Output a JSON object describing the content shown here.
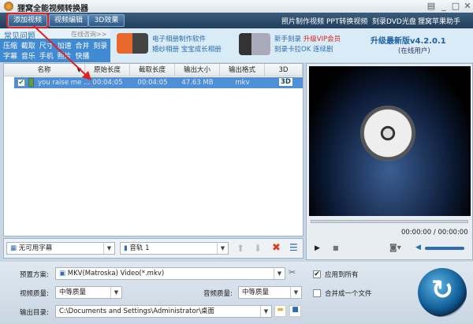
{
  "window": {
    "title": "狸窝全能视频转换器"
  },
  "toolbar": {
    "add_video": "添加视频",
    "edit_video": "视频编辑",
    "effect_3d": "3D效果",
    "links": [
      "照片制作视频",
      "PPT转换视频",
      "刻录DVD光盘",
      "狸窝苹果助手"
    ]
  },
  "faq": {
    "title": "常见问题",
    "online": "在线咨询>>",
    "row1": "压缩 截取 尺寸 加速 合并 刻录",
    "row2": "字幕 音乐 手机 照片 快播"
  },
  "promo1": {
    "line1": "电子相册制作软件",
    "line2": "婚纱相册  宝宝成长相册"
  },
  "promo2": {
    "line1": "新手刻录",
    "vip": "升级VIP会员",
    "line2": "刻录卡拉OK 连续剧"
  },
  "upgrade": {
    "title": "升级最新版v4.2.0.1",
    "sub": "(在线用户)"
  },
  "table": {
    "headers": [
      "名称",
      "原始长度",
      "截取长度",
      "输出大小",
      "输出格式",
      "3D"
    ],
    "rows": [
      {
        "checked": true,
        "name": "you raise me ...",
        "original": "00:04:05",
        "clip": "00:04:05",
        "size": "47.63 MB",
        "format": "mkv",
        "d3": "3D"
      }
    ]
  },
  "player": {
    "time": "00:00:00 / 00:00:00"
  },
  "subtitle": {
    "value": "无可用字幕"
  },
  "audio_track": {
    "value": "音轨 1"
  },
  "settings": {
    "preset_label": "预置方案:",
    "preset_value": "MKV(Matroska) Video(*.mkv)",
    "video_quality_label": "视频质量:",
    "video_quality": "中等质量",
    "audio_quality_label": "音频质量:",
    "audio_quality": "中等质量",
    "output_label": "输出目录:",
    "output_value": "C:\\Documents and Settings\\Administrator\\桌面",
    "apply_all": "应用到所有",
    "apply_all_checked": true,
    "merge": "合并成一个文件",
    "merge_checked": false
  },
  "colors": {
    "toolbar": "#223f5c",
    "selection": "#4f8fd6",
    "highlight": "#e02020"
  }
}
